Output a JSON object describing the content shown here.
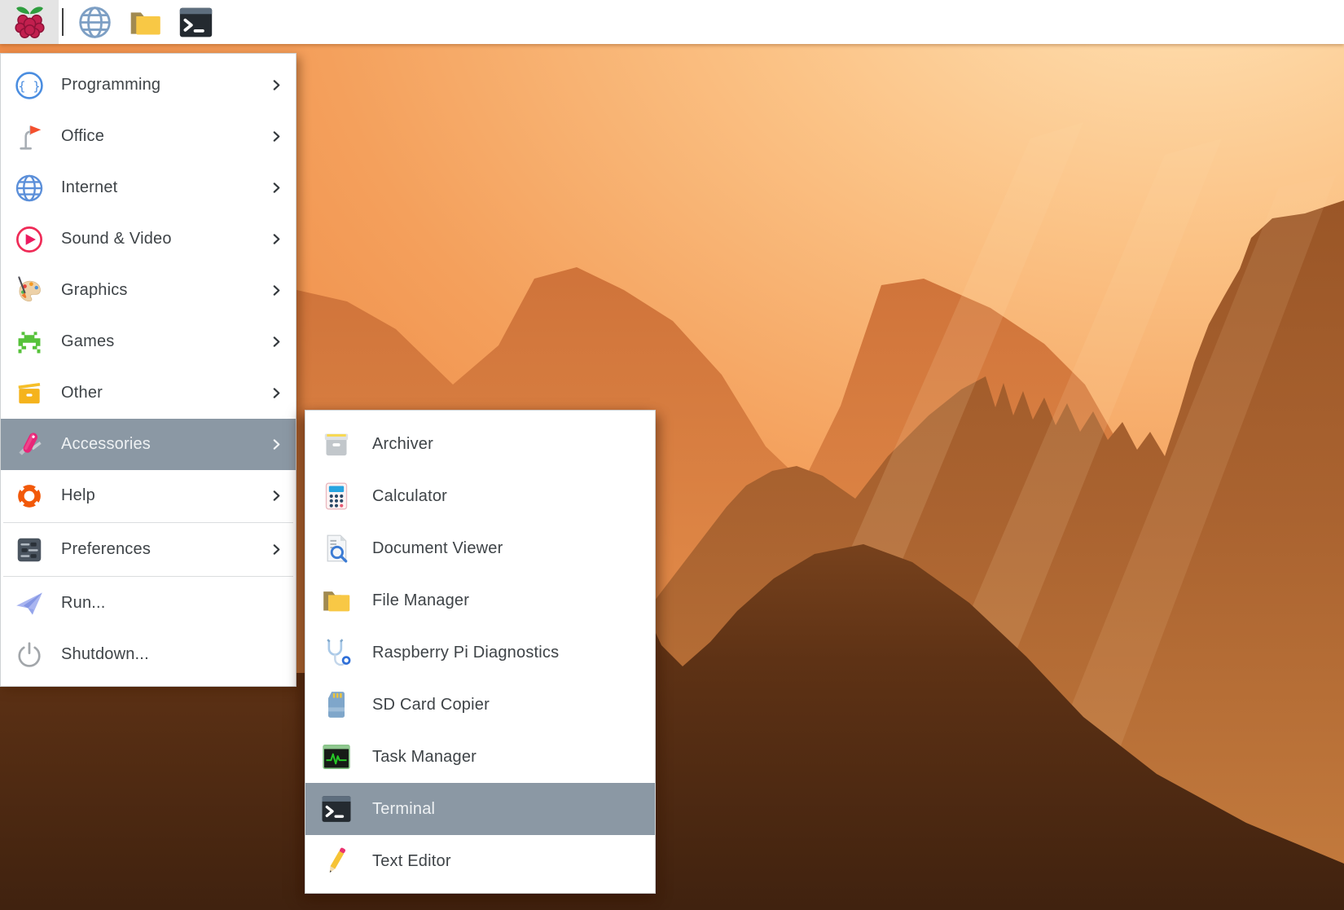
{
  "taskbar": {
    "buttons": [
      {
        "label": "applications-menu",
        "icon": "raspberry-icon",
        "pressed": true
      },
      {
        "label": "web-browser",
        "icon": "globe-icon",
        "pressed": false
      },
      {
        "label": "file-manager",
        "icon": "folder-icon",
        "pressed": false
      },
      {
        "label": "terminal",
        "icon": "terminal-icon",
        "pressed": false
      }
    ]
  },
  "main_menu": {
    "items": [
      {
        "label": "Programming",
        "icon": "braces-circle-icon",
        "submenu_arrow": true,
        "selected": false
      },
      {
        "label": "Office",
        "icon": "desk-lamp-icon",
        "submenu_arrow": true,
        "selected": false
      },
      {
        "label": "Internet",
        "icon": "internet-globe-icon",
        "submenu_arrow": true,
        "selected": false
      },
      {
        "label": "Sound & Video",
        "icon": "play-circle-icon",
        "submenu_arrow": true,
        "selected": false
      },
      {
        "label": "Graphics",
        "icon": "palette-icon",
        "submenu_arrow": true,
        "selected": false
      },
      {
        "label": "Games",
        "icon": "space-invader-icon",
        "submenu_arrow": true,
        "selected": false
      },
      {
        "label": "Other",
        "icon": "yellow-box-icon",
        "submenu_arrow": true,
        "selected": false
      },
      {
        "label": "Accessories",
        "icon": "swiss-army-knife-icon",
        "submenu_arrow": true,
        "selected": true
      },
      {
        "label": "Help",
        "icon": "lifebuoy-icon",
        "submenu_arrow": true,
        "selected": false
      },
      {
        "type": "separator"
      },
      {
        "label": "Preferences",
        "icon": "sliders-icon",
        "submenu_arrow": true,
        "selected": false
      },
      {
        "type": "separator"
      },
      {
        "label": "Run...",
        "icon": "paper-plane-icon",
        "submenu_arrow": false,
        "selected": false
      },
      {
        "label": "Shutdown...",
        "icon": "power-icon",
        "submenu_arrow": false,
        "selected": false
      }
    ]
  },
  "submenu": {
    "items": [
      {
        "label": "Archiver",
        "icon": "archive-box-icon",
        "selected": false
      },
      {
        "label": "Calculator",
        "icon": "calculator-icon",
        "selected": false
      },
      {
        "label": "Document Viewer",
        "icon": "document-search-icon",
        "selected": false
      },
      {
        "label": "File Manager",
        "icon": "folder-icon",
        "selected": false
      },
      {
        "label": "Raspberry Pi Diagnostics",
        "icon": "stethoscope-icon",
        "selected": false
      },
      {
        "label": "SD Card Copier",
        "icon": "sd-card-icon",
        "selected": false
      },
      {
        "label": "Task Manager",
        "icon": "task-monitor-icon",
        "selected": false
      },
      {
        "label": "Terminal",
        "icon": "terminal-icon",
        "selected": true
      },
      {
        "label": "Text Editor",
        "icon": "pencil-icon",
        "selected": false
      }
    ]
  },
  "colors": {
    "highlight": "#8b98a4",
    "menu_background": "#ffffff",
    "menu_text": "#3e4347",
    "selected_text": "#eef1f3",
    "taskbar_background": "#ffffff",
    "sky_top_right": "#ffe0af",
    "sky_orange": "#ee8540",
    "far_mountain": "#d2763b",
    "mid_mountain": "#a35d2c",
    "foreground_mountain_dark": "#42230f"
  }
}
